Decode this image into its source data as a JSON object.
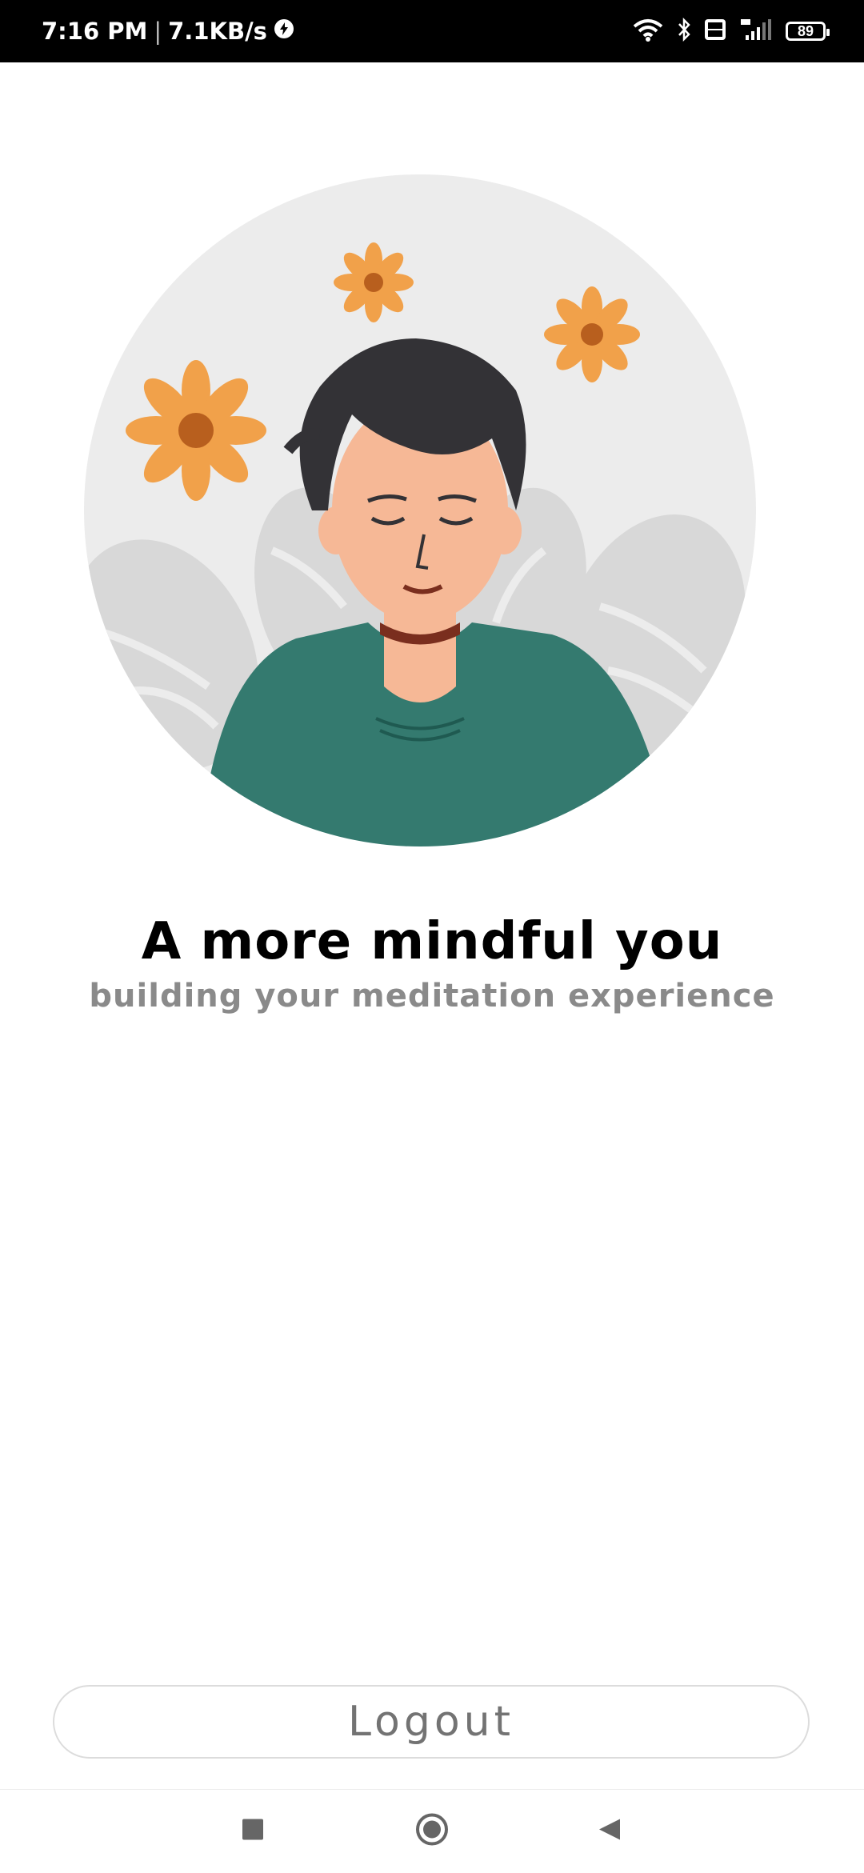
{
  "status_bar": {
    "time": "7:16 PM",
    "separator": "|",
    "net_speed": "7.1KB/s",
    "battery": "89",
    "icons": [
      "data-saver-icon",
      "wifi-icon",
      "bluetooth-icon",
      "volte-icon",
      "signal-4g-icon",
      "battery-icon"
    ]
  },
  "hero": {
    "illustration": "meditating-person-with-flowers"
  },
  "main": {
    "title": "A more mindful you",
    "subtitle": "building your meditation experience"
  },
  "actions": {
    "logout_label": "Logout"
  },
  "nav": {
    "icons": [
      "recents-square-icon",
      "home-circle-icon",
      "back-triangle-icon"
    ]
  },
  "colors": {
    "circle_bg": "#ececec",
    "shirt": "#347a6f",
    "hair": "#333236",
    "skin": "#f6b896",
    "flower": "#f1a14a",
    "subtitle": "#8a8a8a"
  }
}
